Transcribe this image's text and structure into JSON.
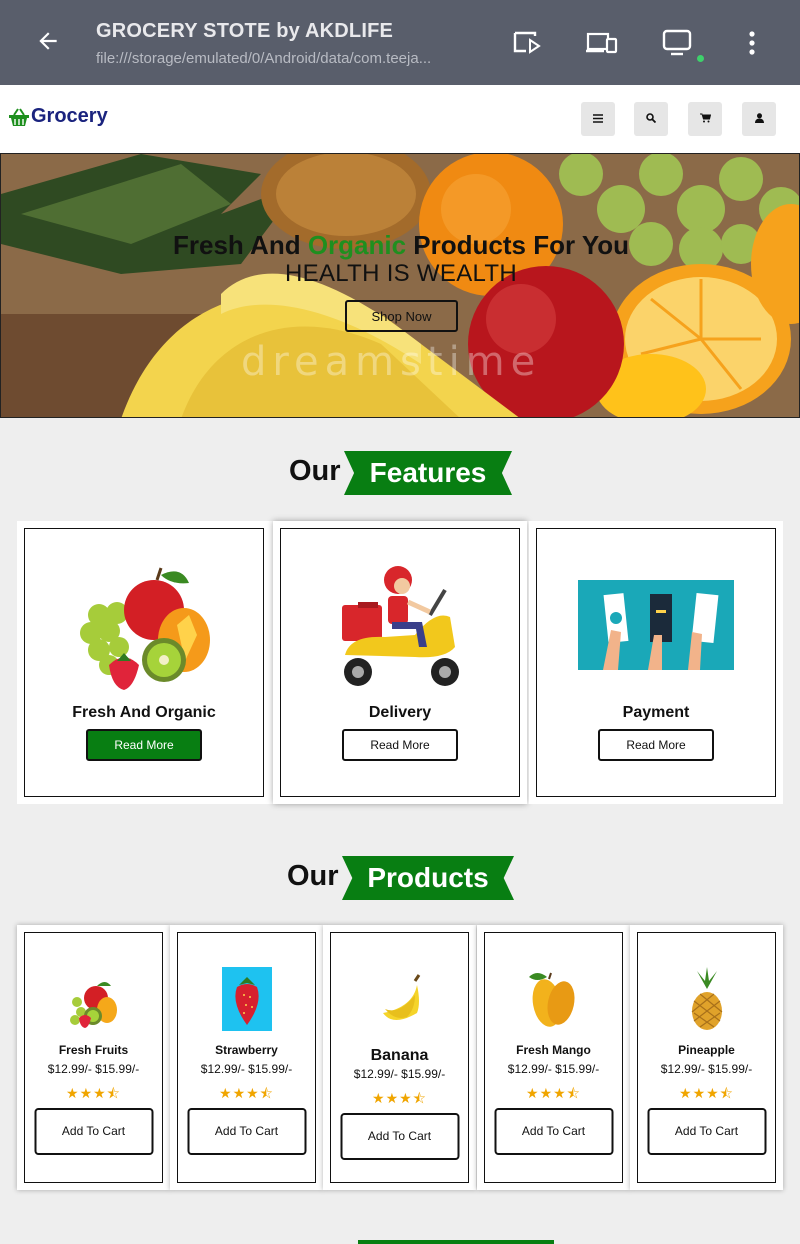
{
  "appbar": {
    "title": "GROCERY STOTE by AKDLIFE",
    "url": "file:///storage/emulated/0/Android/data/com.teeja...",
    "icons": [
      "back-arrow-icon",
      "cast-icon",
      "devices-icon",
      "monitor-icon",
      "more-vert-icon"
    ],
    "status_dot_color": "#3ed16b"
  },
  "header": {
    "brand": "Grocery",
    "brand_color": "#1a237e",
    "icons": [
      "menu-icon",
      "search-icon",
      "cart-icon",
      "user-icon"
    ]
  },
  "hero": {
    "title_before": "Fresh And ",
    "title_highlight": "Organic",
    "title_after": " Products For You",
    "subtitle": "HEALTH IS WEALTH",
    "button": "Shop Now",
    "watermark": "dreamstime"
  },
  "features": {
    "heading_prefix": "Our",
    "heading_label": "Features",
    "items": [
      {
        "name": "Fresh And Organic",
        "button": "Read More",
        "icon": "fruits-illustration"
      },
      {
        "name": "Delivery",
        "button": "Read More",
        "icon": "scooter-delivery-illustration"
      },
      {
        "name": "Payment",
        "button": "Read More",
        "icon": "payment-cards-illustration"
      }
    ]
  },
  "products": {
    "heading_prefix": "Our",
    "heading_label": "Products",
    "items": [
      {
        "name": "Fresh Fruits",
        "price": "$12.99/- $15.99/-",
        "rating": 3.5,
        "button": "Add To Cart",
        "icon": "fruit-bundle-icon"
      },
      {
        "name": "Strawberry",
        "price": "$12.99/- $15.99/-",
        "rating": 3.5,
        "button": "Add To Cart",
        "icon": "strawberry-icon"
      },
      {
        "name": "Banana",
        "price": "$12.99/- $15.99/-",
        "rating": 3.5,
        "button": "Add To Cart",
        "icon": "banana-icon"
      },
      {
        "name": "Fresh Mango",
        "price": "$12.99/- $15.99/-",
        "rating": 3.5,
        "button": "Add To Cart",
        "icon": "mango-icon"
      },
      {
        "name": "Pineapple",
        "price": "$12.99/- $15.99/-",
        "rating": 3.5,
        "button": "Add To Cart",
        "icon": "pineapple-icon"
      }
    ],
    "stars_text": "★★★⯪"
  },
  "colors": {
    "accent_green": "#087e12",
    "appbar": "#595e6b",
    "star": "#f0a500"
  }
}
